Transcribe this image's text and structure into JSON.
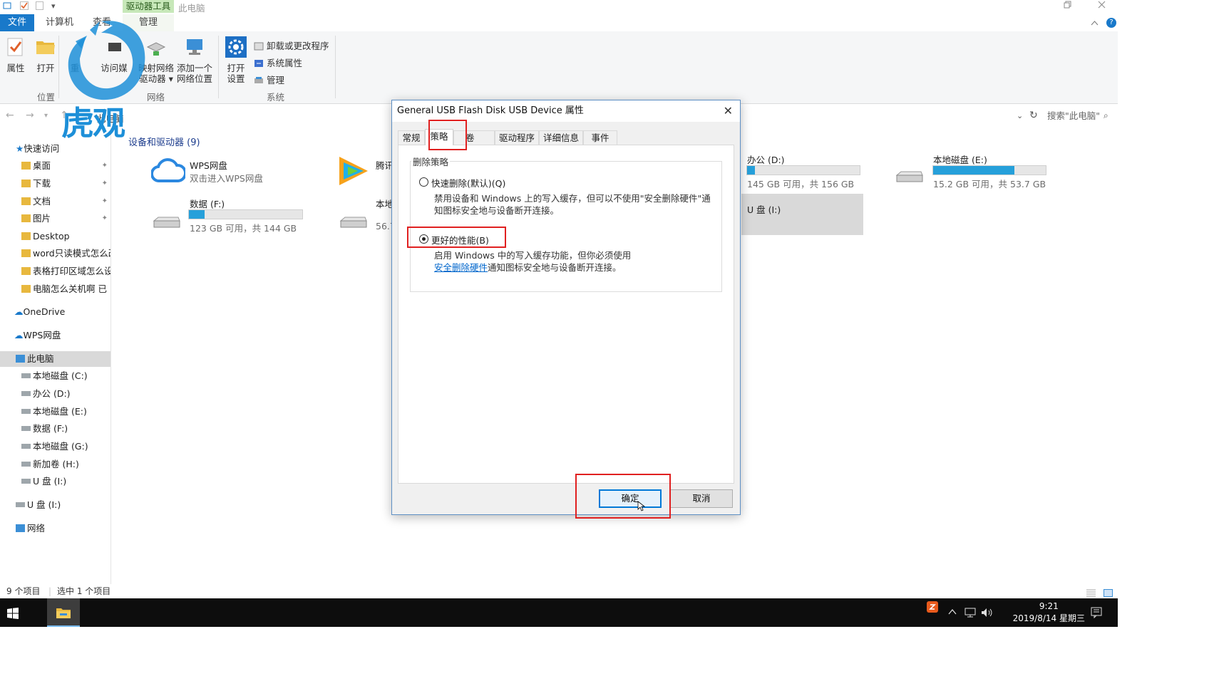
{
  "window": {
    "context_tab": "驱动器工具",
    "title": "此电脑",
    "qat_symbols": [
      "▾"
    ]
  },
  "ribbon": {
    "tabs": [
      "文件",
      "计算机",
      "查看",
      "管理"
    ],
    "buttons": {
      "properties": "属性",
      "open": "打开",
      "rename": "重",
      "access_media": "访问媒",
      "map_drive_1": "映射网络",
      "map_drive_2": "驱动器",
      "add_location_1": "添加一个",
      "add_location_2": "网络位置",
      "open_settings_1": "打开",
      "open_settings_2": "设置",
      "uninstall": "卸载或更改程序",
      "system_props": "系统属性",
      "manage": "管理"
    },
    "groups": [
      "位置",
      "网络",
      "系统"
    ]
  },
  "address": {
    "path": "此电脑",
    "search_placeholder": "搜索\"此电脑\""
  },
  "nav": {
    "quick_access": "快速访问",
    "items": [
      {
        "label": "桌面",
        "pinned": true
      },
      {
        "label": "下载",
        "pinned": true
      },
      {
        "label": "文档",
        "pinned": true
      },
      {
        "label": "图片",
        "pinned": true
      },
      {
        "label": "Desktop"
      },
      {
        "label": "word只读模式怎么改"
      },
      {
        "label": "表格打印区域怎么设"
      },
      {
        "label": "电脑怎么关机啊  已"
      }
    ],
    "onedrive": "OneDrive",
    "wps": "WPS网盘",
    "this_pc": "此电脑",
    "drives": [
      "本地磁盘 (C:)",
      "办公 (D:)",
      "本地磁盘 (E:)",
      "数据 (F:)",
      "本地磁盘 (G:)",
      "新加卷 (H:)",
      "U 盘 (I:)"
    ],
    "usb_root": "U 盘 (I:)",
    "network": "网络"
  },
  "content": {
    "group_header": "设备和驱动器 (9)",
    "wps_name": "WPS网盘",
    "wps_sub": "双击进入WPS网盘",
    "tencent_name": "腾讯",
    "drive_f_name": "数据 (F:)",
    "drive_f_sub": "123 GB 可用，共 144 GB",
    "drive_f_fill": 0.14,
    "local_partial_name": "本地",
    "local_partial_sub": "56.7",
    "drive_d_name": "办公 (D:)",
    "drive_d_sub": "145 GB 可用，共 156 GB",
    "drive_d_fill": 0.07,
    "drive_e_name": "本地磁盘 (E:)",
    "drive_e_sub": "15.2 GB 可用，共 53.7 GB",
    "drive_e_fill": 0.72,
    "usb_name": "U 盘 (I:)"
  },
  "status": {
    "count": "9 个项目",
    "selected": "选中 1 个项目"
  },
  "taskbar": {
    "time": "9:21",
    "date": "2019/8/14 星期三"
  },
  "dialog": {
    "title": "General USB Flash Disk USB Device 属性",
    "tabs": [
      "常规",
      "策略",
      "卷",
      "驱动程序",
      "详细信息",
      "事件"
    ],
    "group_title": "删除策略",
    "option1_label": "快速删除(默认)(Q)",
    "option1_desc_1": "禁用设备和 Windows 上的写入缓存，但可以不使用\"安全删除硬件\"通",
    "option1_desc_2": "知图标安全地与设备断开连接。",
    "option2_label": "更好的性能(B)",
    "option2_desc_1": "启用 Windows 中的写入缓存功能，但你必须使用",
    "option2_link": "安全删除硬件",
    "option2_desc_2": "通知图标安全地与设备断开连接。",
    "selected_option": "option2",
    "ok": "确定",
    "cancel": "取消"
  },
  "watermark": {
    "text": "虎观"
  },
  "colors": {
    "accent": "#1979ca",
    "highlight": "#e02020",
    "bar_fill": "#26a0da",
    "context_tab": "#c7e8b9"
  }
}
